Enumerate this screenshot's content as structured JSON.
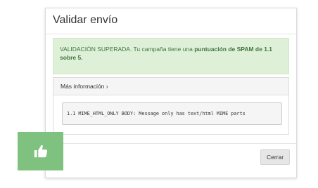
{
  "modal": {
    "title": "Validar envío",
    "alert": {
      "prefix": "VALIDACIÓN SUPERADA. Tu campaña tiene una ",
      "highlight": "puntuación de SPAM de 1.1 sobre 5."
    },
    "details": {
      "heading": "Más información ›",
      "code": "1.1 MIME_HTML_ONLY BODY: Message only has text/html MIME parts"
    },
    "footer": {
      "close_label": "Cerrar"
    }
  },
  "badge": {
    "icon": "thumbs-up-icon",
    "color": "#7fc17e"
  },
  "colors": {
    "success_bg": "#dff0d8",
    "success_text": "#3c763d"
  }
}
